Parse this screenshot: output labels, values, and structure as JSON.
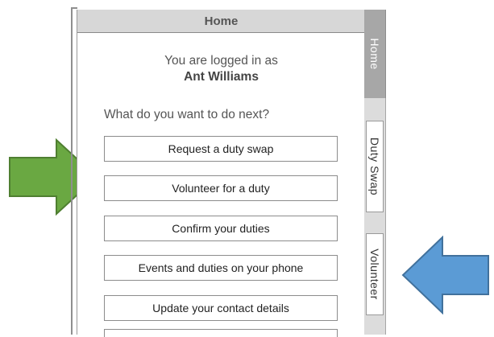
{
  "panel": {
    "title": "Home",
    "logged_in_text": "You are logged in as",
    "user_name": "Ant Williams",
    "question": "What do you want to do next?",
    "actions": [
      {
        "label": "Request a duty swap"
      },
      {
        "label": "Volunteer for a duty"
      },
      {
        "label": "Confirm your duties"
      },
      {
        "label": "Events and duties on your phone"
      },
      {
        "label": "Update your contact details"
      }
    ]
  },
  "tabs": {
    "home": "Home",
    "duty_swap": "Duty Swap",
    "volunteer": "Volunteer"
  },
  "annotations": {
    "green_arrow": {
      "color": "#6aa842",
      "stroke": "#4f7f31",
      "direction": "right"
    },
    "blue_arrow": {
      "color": "#5b9bd5",
      "stroke": "#41719c",
      "direction": "left"
    }
  }
}
